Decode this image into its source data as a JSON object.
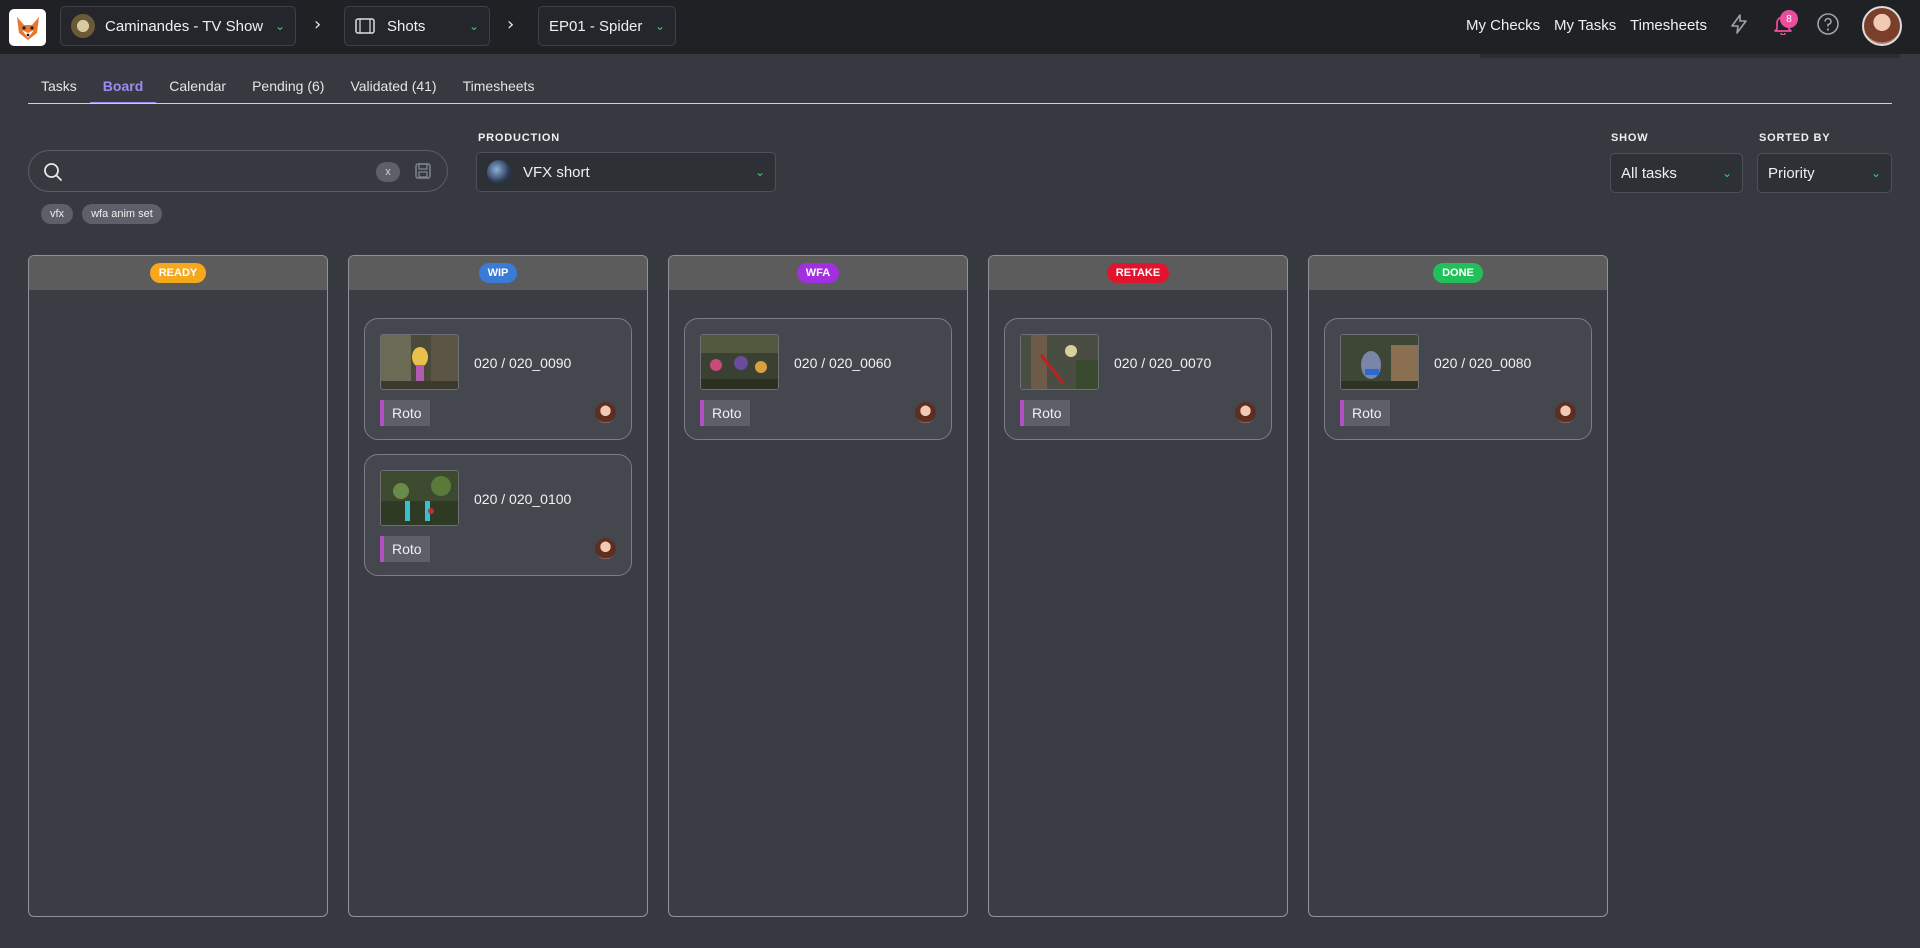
{
  "topbar": {
    "production": {
      "label": "Caminandes - TV Show"
    },
    "section": {
      "label": "Shots"
    },
    "episode": {
      "label": "EP01 - Spider"
    },
    "links": [
      "My Checks",
      "My Tasks",
      "Timesheets"
    ],
    "notification_count": "8"
  },
  "tabs": [
    "Tasks",
    "Board",
    "Calendar",
    "Pending (6)",
    "Validated (41)",
    "Timesheets"
  ],
  "active_tab": "Board",
  "filters": {
    "search_value": "",
    "clear_label": "x",
    "chips": [
      "vfx",
      "wfa anim set"
    ],
    "production_label": "PRODUCTION",
    "production_value": "VFX short",
    "show_label": "SHOW",
    "show_value": "All tasks",
    "sorted_label": "SORTED BY",
    "sorted_value": "Priority"
  },
  "board": {
    "columns": [
      {
        "status": "READY",
        "color": "#f5a81c",
        "cards": []
      },
      {
        "status": "WIP",
        "color": "#3a7bd5",
        "cards": [
          {
            "name": "020 / 020_0090",
            "task": "Roto"
          },
          {
            "name": "020 / 020_0100",
            "task": "Roto"
          }
        ]
      },
      {
        "status": "WFA",
        "color": "#a22fe0",
        "cards": [
          {
            "name": "020 / 020_0060",
            "task": "Roto"
          }
        ]
      },
      {
        "status": "RETAKE",
        "color": "#e0152d",
        "cards": [
          {
            "name": "020 / 020_0070",
            "task": "Roto"
          }
        ]
      },
      {
        "status": "DONE",
        "color": "#22c05a",
        "cards": [
          {
            "name": "020 / 020_0080",
            "task": "Roto"
          }
        ]
      }
    ]
  },
  "colors": {
    "accent": "#9b8cf2",
    "task_type": "#b44fc6",
    "chevron": "#3bd06a"
  }
}
